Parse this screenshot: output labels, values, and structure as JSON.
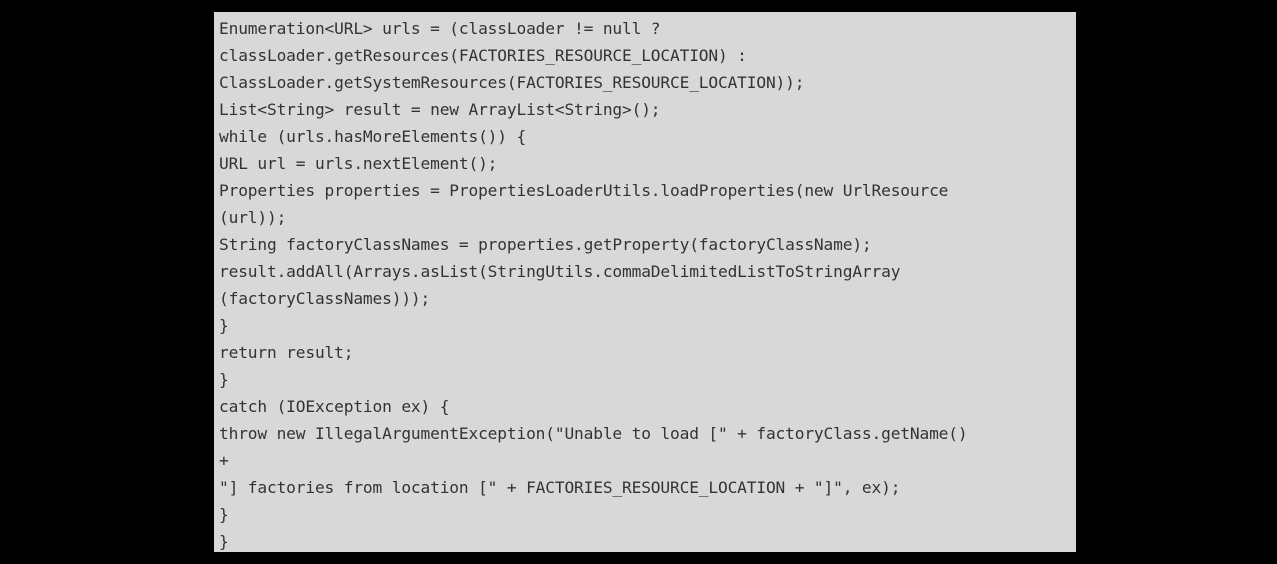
{
  "code": {
    "lines": [
      "Enumeration<URL> urls = (classLoader != null ?",
      "classLoader.getResources(FACTORIES_RESOURCE_LOCATION) :",
      "ClassLoader.getSystemResources(FACTORIES_RESOURCE_LOCATION));",
      "List<String> result = new ArrayList<String>();",
      "while (urls.hasMoreElements()) {",
      "URL url = urls.nextElement();",
      "Properties properties = PropertiesLoaderUtils.loadProperties(new UrlResource",
      "(url));",
      "String factoryClassNames = properties.getProperty(factoryClassName);",
      "result.addAll(Arrays.asList(StringUtils.commaDelimitedListToStringArray",
      "(factoryClassNames)));",
      "}",
      "return result;",
      "}",
      "catch (IOException ex) {",
      "throw new IllegalArgumentException(\"Unable to load [\" + factoryClass.getName()",
      "+",
      "\"] factories from location [\" + FACTORIES_RESOURCE_LOCATION + \"]\", ex);",
      "}",
      "}"
    ]
  },
  "colors": {
    "background": "#000000",
    "code_background": "#d8d8d8",
    "code_text": "#333333"
  }
}
